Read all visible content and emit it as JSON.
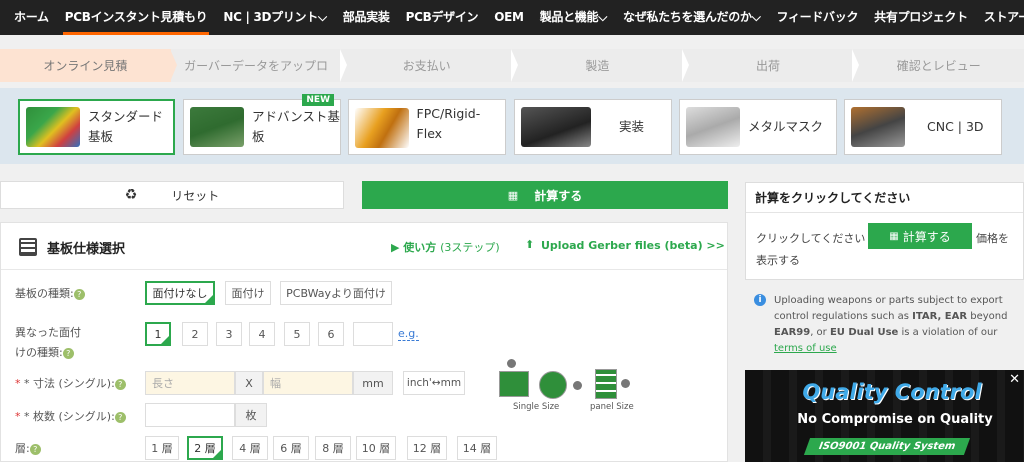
{
  "nav": {
    "items": [
      "ホーム",
      "PCBインスタント見積もり",
      "NC | 3Dプリント",
      "部品実装",
      "PCBデザイン",
      "OEM",
      "製品と機能",
      "なぜ私たちを選んだのか",
      "フィードバック",
      "共有プロジェクト",
      "ストアー"
    ],
    "dropdown_marks": [
      "",
      "",
      "⌵",
      "",
      "",
      "",
      "⌵",
      "⌵",
      "",
      "",
      ""
    ]
  },
  "steps": [
    "オンライン見積",
    "ガーバーデータをアップロ",
    "お支払い",
    "製造",
    "出荷",
    "確認とレビュー"
  ],
  "products": [
    {
      "label1": "スタンダード",
      "label2": "基板"
    },
    {
      "label1": "アドバンスト基",
      "label2": "板",
      "badge": "NEW"
    },
    {
      "label1": "FPC/Rigid-Flex",
      "label2": ""
    },
    {
      "label1": "実装",
      "label2": ""
    },
    {
      "label1": "メタルマスク",
      "label2": ""
    },
    {
      "label1": "CNC | 3D",
      "label2": ""
    }
  ],
  "toolbar": {
    "reset_label": "リセット",
    "calc_label": "計算する"
  },
  "spec": {
    "title": "基板仕様選択",
    "howto": "▶ 使い方",
    "howto_steps": "(3ステップ)",
    "upload": "Upload Gerber files (beta) >>"
  },
  "rows": {
    "type_label": "基板の種類:",
    "type_options": [
      "面付けなし",
      "面付け",
      "PCBWayより面付け"
    ],
    "diff_label1": "異なった面付",
    "diff_label2": "けの種類:",
    "diff_options": [
      "1",
      "2",
      "3",
      "4",
      "5",
      "6"
    ],
    "eg": "e.g.",
    "size_label": "* 寸法 (シングル):",
    "size_len_ph": "長さ",
    "size_x": "X",
    "size_w_ph": "幅",
    "size_unit": "mm",
    "convert": "inch'↔mm",
    "qty_label": "* 枚数 (シングル):",
    "qty_unit": "枚",
    "layer_label": "層:",
    "layer_options": [
      "1 層",
      "2 層",
      "4 層",
      "6 層",
      "8 層",
      "10 層",
      "12 層",
      "14 層"
    ],
    "single_size": "Single Size",
    "panel_size": "panel Size"
  },
  "side": {
    "title": "計算をクリックしてください",
    "text1": "クリックしてください",
    "btn": "計算する",
    "text2": "価格を",
    "text3": "表示する"
  },
  "notice": {
    "t1": "Uploading weapons or parts subject to export control regulations such as ",
    "b1": "ITAR, EAR",
    "t2": " beyond ",
    "b2": "EAR99",
    "t3": ", or ",
    "b3": "EU Dual Use",
    "t4": " is a violation of our",
    "link": "terms of use"
  },
  "ad": {
    "title": "Quality Control",
    "subtitle": "No Compromise on Quality",
    "badge": "ISO9001 Quality System"
  },
  "colors": {
    "accent": "#2ca84d",
    "nav_bg": "#222222",
    "active_underline": "#ff6600"
  }
}
